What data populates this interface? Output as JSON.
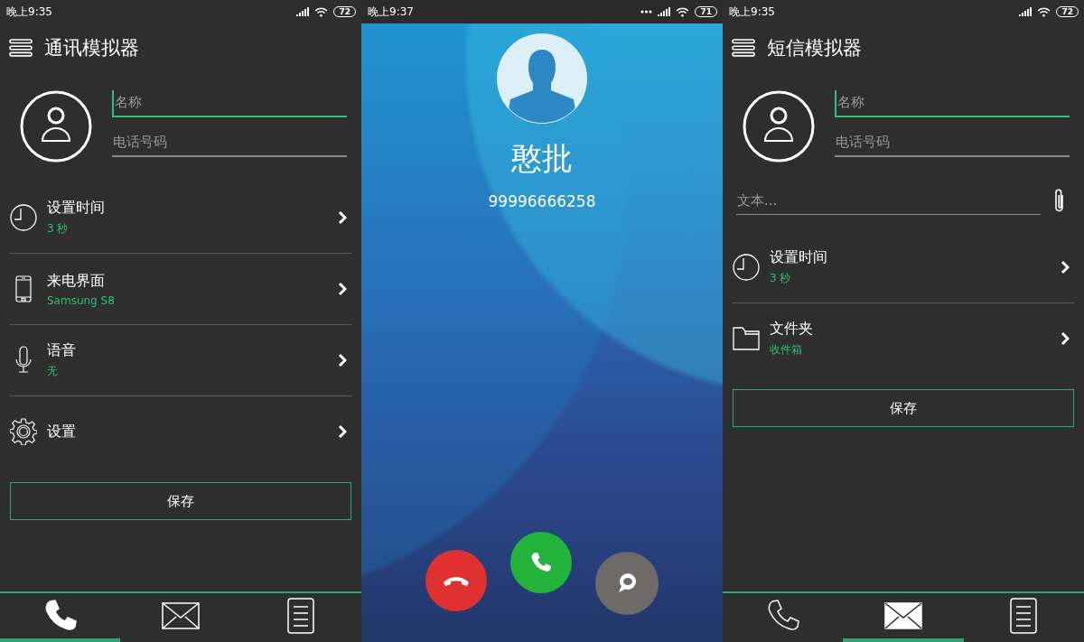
{
  "screens": [
    {
      "kind": "form",
      "status_bar": {
        "time": "晚上9:35",
        "battery": "72",
        "more_notifications": false
      },
      "title": "通讯模拟器",
      "fields": [
        {
          "placeholder": "名称",
          "focused": true
        },
        {
          "placeholder": "电话号码",
          "focused": false
        }
      ],
      "settings": [
        {
          "kind": "clock",
          "label": "设置时间",
          "value": "3 秒"
        },
        {
          "kind": "phone",
          "label": "来电界面",
          "value": "Samsung S8"
        },
        {
          "kind": "microphone",
          "label": "语音",
          "value": "无"
        },
        {
          "kind": "gear",
          "label": "设置"
        }
      ],
      "save_button": "保存",
      "nav": [
        {
          "kind": "phone",
          "selected": true
        },
        {
          "kind": "mail",
          "selected": false
        },
        {
          "kind": "document",
          "selected": false
        }
      ]
    },
    {
      "kind": "incoming_call",
      "status_bar": {
        "time": "晚上9:37",
        "battery": "71",
        "more_notifications": true
      },
      "caller_name": "憨批",
      "caller_number": "99996666258",
      "actions": [
        {
          "kind": "decline"
        },
        {
          "kind": "accept"
        },
        {
          "kind": "message"
        }
      ]
    },
    {
      "kind": "form",
      "status_bar": {
        "time": "晚上9:35",
        "battery": "72",
        "more_notifications": false
      },
      "title": "短信模拟器",
      "fields": [
        {
          "placeholder": "名称",
          "focused": true
        },
        {
          "placeholder": "电话号码",
          "focused": false
        }
      ],
      "message_field": {
        "placeholder": "文本..."
      },
      "settings": [
        {
          "kind": "clock",
          "label": "设置时间",
          "value": "3 秒"
        },
        {
          "kind": "folder",
          "label": "文件夹",
          "value": "收件箱"
        }
      ],
      "save_button": "保存",
      "nav": [
        {
          "kind": "phone",
          "selected": false
        },
        {
          "kind": "mail",
          "selected": true
        },
        {
          "kind": "document",
          "selected": false
        }
      ]
    }
  ]
}
